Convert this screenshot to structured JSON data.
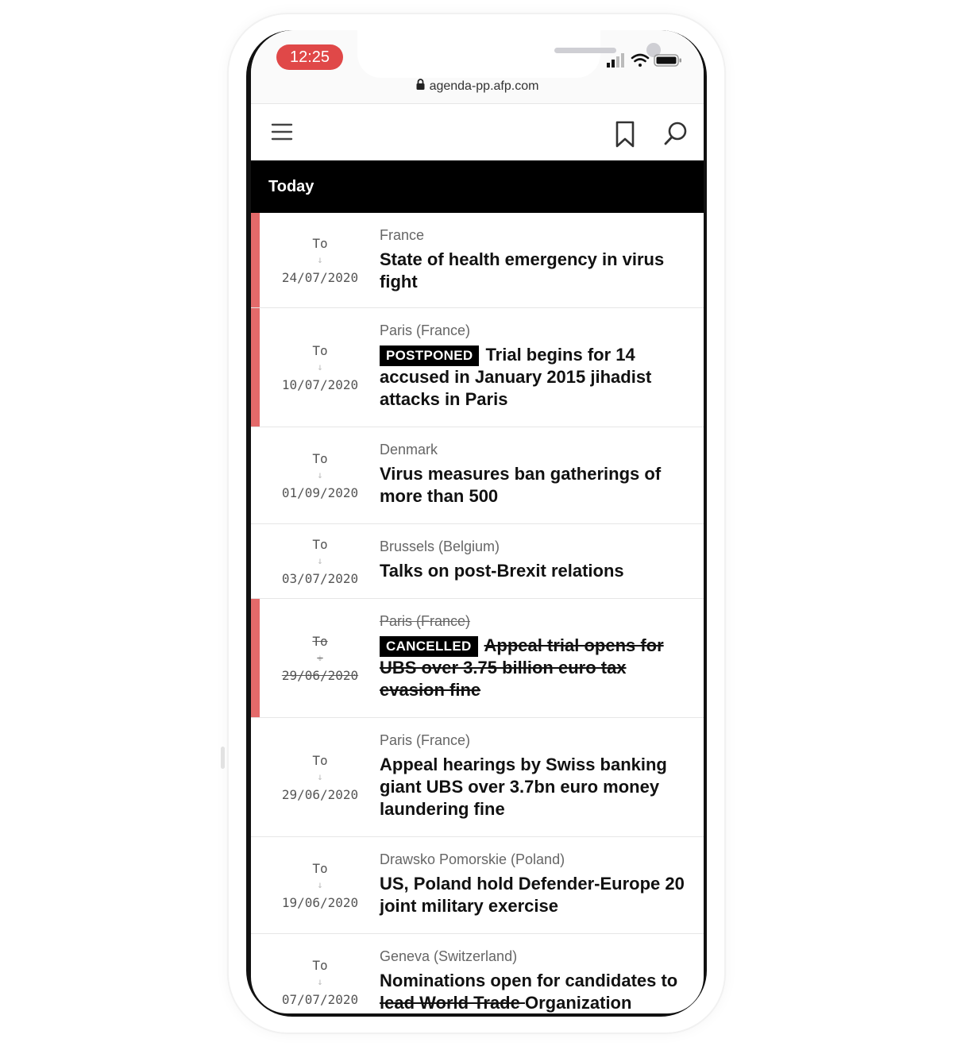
{
  "status_bar": {
    "time": "12:25",
    "url": "agenda-pp.afp.com"
  },
  "nav": {
    "menu_icon": "hamburger-icon",
    "bookmark_icon": "bookmark-icon",
    "search_icon": "search-icon"
  },
  "section": {
    "title": "Today"
  },
  "colors": {
    "flag": "#e46a6a",
    "time_pill": "#e04848"
  },
  "items": [
    {
      "to": "To",
      "date": "24/07/2020",
      "location": "France",
      "badge": "",
      "title": "State of health emergency in virus fight",
      "flagged": true,
      "cancelled": false
    },
    {
      "to": "To",
      "date": "10/07/2020",
      "location": "Paris (France)",
      "badge": "POSTPONED",
      "title": "Trial begins for 14 accused in January 2015 jihadist attacks in Paris",
      "flagged": true,
      "cancelled": false
    },
    {
      "to": "To",
      "date": "01/09/2020",
      "location": "Denmark",
      "badge": "",
      "title": "Virus measures ban gatherings of more than 500",
      "flagged": false,
      "cancelled": false
    },
    {
      "to": "To",
      "date": "03/07/2020",
      "location": "Brussels (Belgium)",
      "badge": "",
      "title": "Talks on post-Brexit relations",
      "flagged": false,
      "cancelled": false
    },
    {
      "to": "To",
      "date": "29/06/2020",
      "location": "Paris (France)",
      "badge": "CANCELLED",
      "title": "Appeal trial opens for UBS over 3.75 billion euro tax evasion fine",
      "flagged": true,
      "cancelled": true
    },
    {
      "to": "To",
      "date": "29/06/2020",
      "location": "Paris (France)",
      "badge": "",
      "title": "Appeal hearings by Swiss banking giant UBS over 3.7bn euro money laundering fine",
      "flagged": false,
      "cancelled": false
    },
    {
      "to": "To",
      "date": "19/06/2020",
      "location": "Drawsko Pomorskie (Poland)",
      "badge": "",
      "title": "US, Poland hold Defender-Europe 20 joint military exercise",
      "flagged": false,
      "cancelled": false
    },
    {
      "to": "To",
      "date": "07/07/2020",
      "location": "Geneva (Switzerland)",
      "badge": "",
      "title_a": "Nominations open for candidates to ",
      "title_b": "lead World Trade ",
      "title_c": "Organization",
      "flagged": false,
      "cancelled": false
    }
  ]
}
